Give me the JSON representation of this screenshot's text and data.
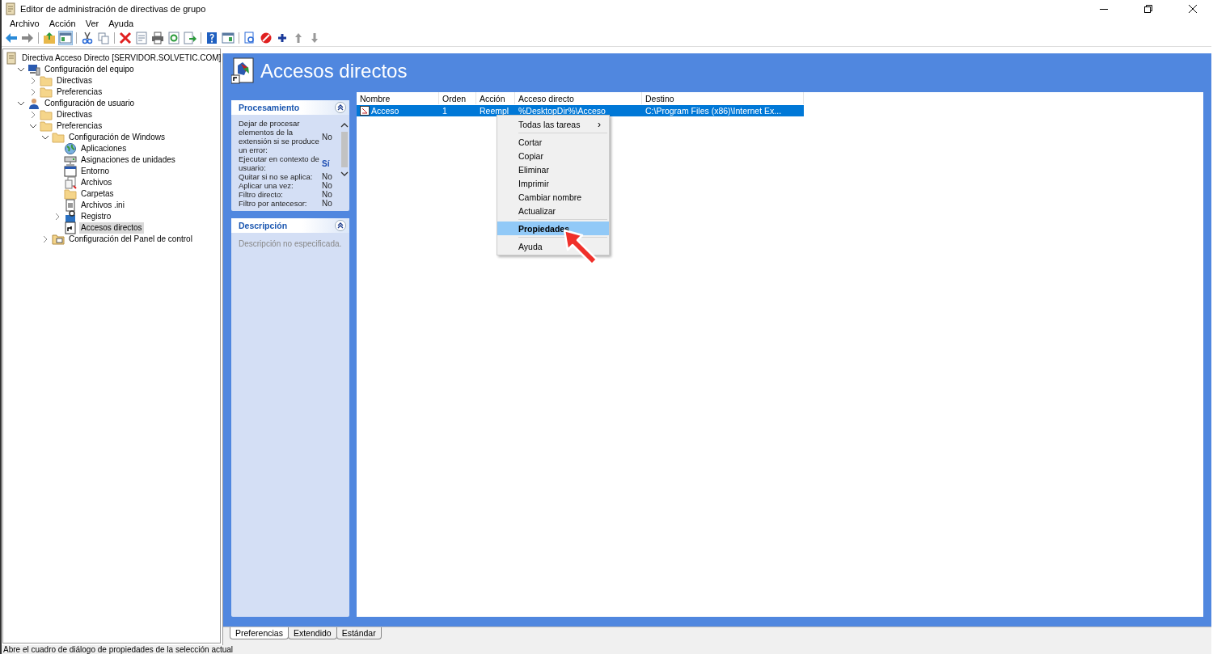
{
  "window": {
    "title": "Editor de administración de directivas de grupo"
  },
  "menu_bar": [
    "Archivo",
    "Acción",
    "Ver",
    "Ayuda"
  ],
  "tree": {
    "label": "Directiva Acceso Directo [SERVIDOR.SOLVETIC.COM]",
    "kind": "policy",
    "children": [
      {
        "label": "Configuración del equipo",
        "kind": "computer",
        "expanded": true,
        "selected": false,
        "children": [
          {
            "label": "Directivas",
            "kind": "folder",
            "expanded": false,
            "selected": false
          },
          {
            "label": "Preferencias",
            "kind": "folder",
            "expanded": false,
            "selected": false
          }
        ]
      },
      {
        "label": "Configuración de usuario",
        "kind": "user",
        "expanded": true,
        "selected": false,
        "children": [
          {
            "label": "Directivas",
            "kind": "folder",
            "expanded": false,
            "selected": false
          },
          {
            "label": "Preferencias",
            "kind": "folder",
            "expanded": true,
            "selected": false,
            "children": [
              {
                "label": "Configuración de Windows",
                "kind": "folder",
                "expanded": true,
                "selected": false,
                "children": [
                  {
                    "label": "Aplicaciones",
                    "kind": "globe",
                    "selected": false
                  },
                  {
                    "label": "Asignaciones de unidades",
                    "kind": "drive",
                    "selected": false
                  },
                  {
                    "label": "Entorno",
                    "kind": "window",
                    "selected": false
                  },
                  {
                    "label": "Archivos",
                    "kind": "files",
                    "selected": false
                  },
                  {
                    "label": "Carpetas",
                    "kind": "folder",
                    "selected": false
                  },
                  {
                    "label": "Archivos .ini",
                    "kind": "ini",
                    "selected": false
                  },
                  {
                    "label": "Registro",
                    "kind": "registry",
                    "expanded": false,
                    "selected": false
                  },
                  {
                    "label": "Accesos directos",
                    "kind": "shortcut",
                    "selected": true
                  }
                ]
              },
              {
                "label": "Configuración del Panel de control",
                "kind": "controlpanel",
                "expanded": false,
                "selected": false
              }
            ]
          }
        ]
      }
    ]
  },
  "header": {
    "title": "Accesos directos"
  },
  "processing_panel": {
    "title": "Procesamiento",
    "rows": [
      {
        "label": "Dejar de procesar elementos de la extensión si se produce un error:",
        "value": "No",
        "kind": "text"
      },
      {
        "label": "Ejecutar en contexto de usuario:",
        "value": "Sí",
        "kind": "link"
      },
      {
        "label": "Quitar si no se aplica:",
        "value": "No",
        "kind": "text"
      },
      {
        "label": "Aplicar una vez:",
        "value": "No",
        "kind": "text"
      },
      {
        "label": "Filtro directo:",
        "value": "No",
        "kind": "text"
      },
      {
        "label": "Filtro por antecesor:",
        "value": "No",
        "kind": "text"
      }
    ]
  },
  "description_panel": {
    "title": "Descripción",
    "text": "Descripción no especificada."
  },
  "table": {
    "columns": [
      "Nombre",
      "Orden",
      "Acción",
      "Acceso directo",
      "Destino"
    ],
    "rows": [
      {
        "cells": [
          "Acceso",
          "1",
          "Reempl",
          "%DesktopDir%\\Acceso",
          "C:\\Program Files (x86)\\Internet Ex..."
        ],
        "selected": true
      }
    ]
  },
  "context_menu": {
    "items": [
      {
        "kind": "submenu",
        "label": "Todas las tareas",
        "arrow": "›",
        "selected": false
      },
      {
        "kind": "separator"
      },
      {
        "kind": "item",
        "label": "Cortar",
        "selected": false
      },
      {
        "kind": "item",
        "label": "Copiar",
        "selected": false
      },
      {
        "kind": "item",
        "label": "Eliminar",
        "selected": false
      },
      {
        "kind": "item",
        "label": "Imprimir",
        "selected": false
      },
      {
        "kind": "item",
        "label": "Cambiar nombre",
        "selected": false
      },
      {
        "kind": "item",
        "label": "Actualizar",
        "selected": false
      },
      {
        "kind": "separator"
      },
      {
        "kind": "item",
        "label": "Propiedades",
        "selected": true,
        "bold": true
      },
      {
        "kind": "separator"
      },
      {
        "kind": "item",
        "label": "Ayuda",
        "selected": false
      }
    ]
  },
  "bottom_tabs": [
    {
      "label": "Preferencias",
      "selected": true
    },
    {
      "label": "Extendido",
      "selected": false
    },
    {
      "label": "Estándar",
      "selected": false
    }
  ],
  "status_bar": {
    "text": "Abre el cuadro de diálogo de propiedades de la selección actual"
  }
}
